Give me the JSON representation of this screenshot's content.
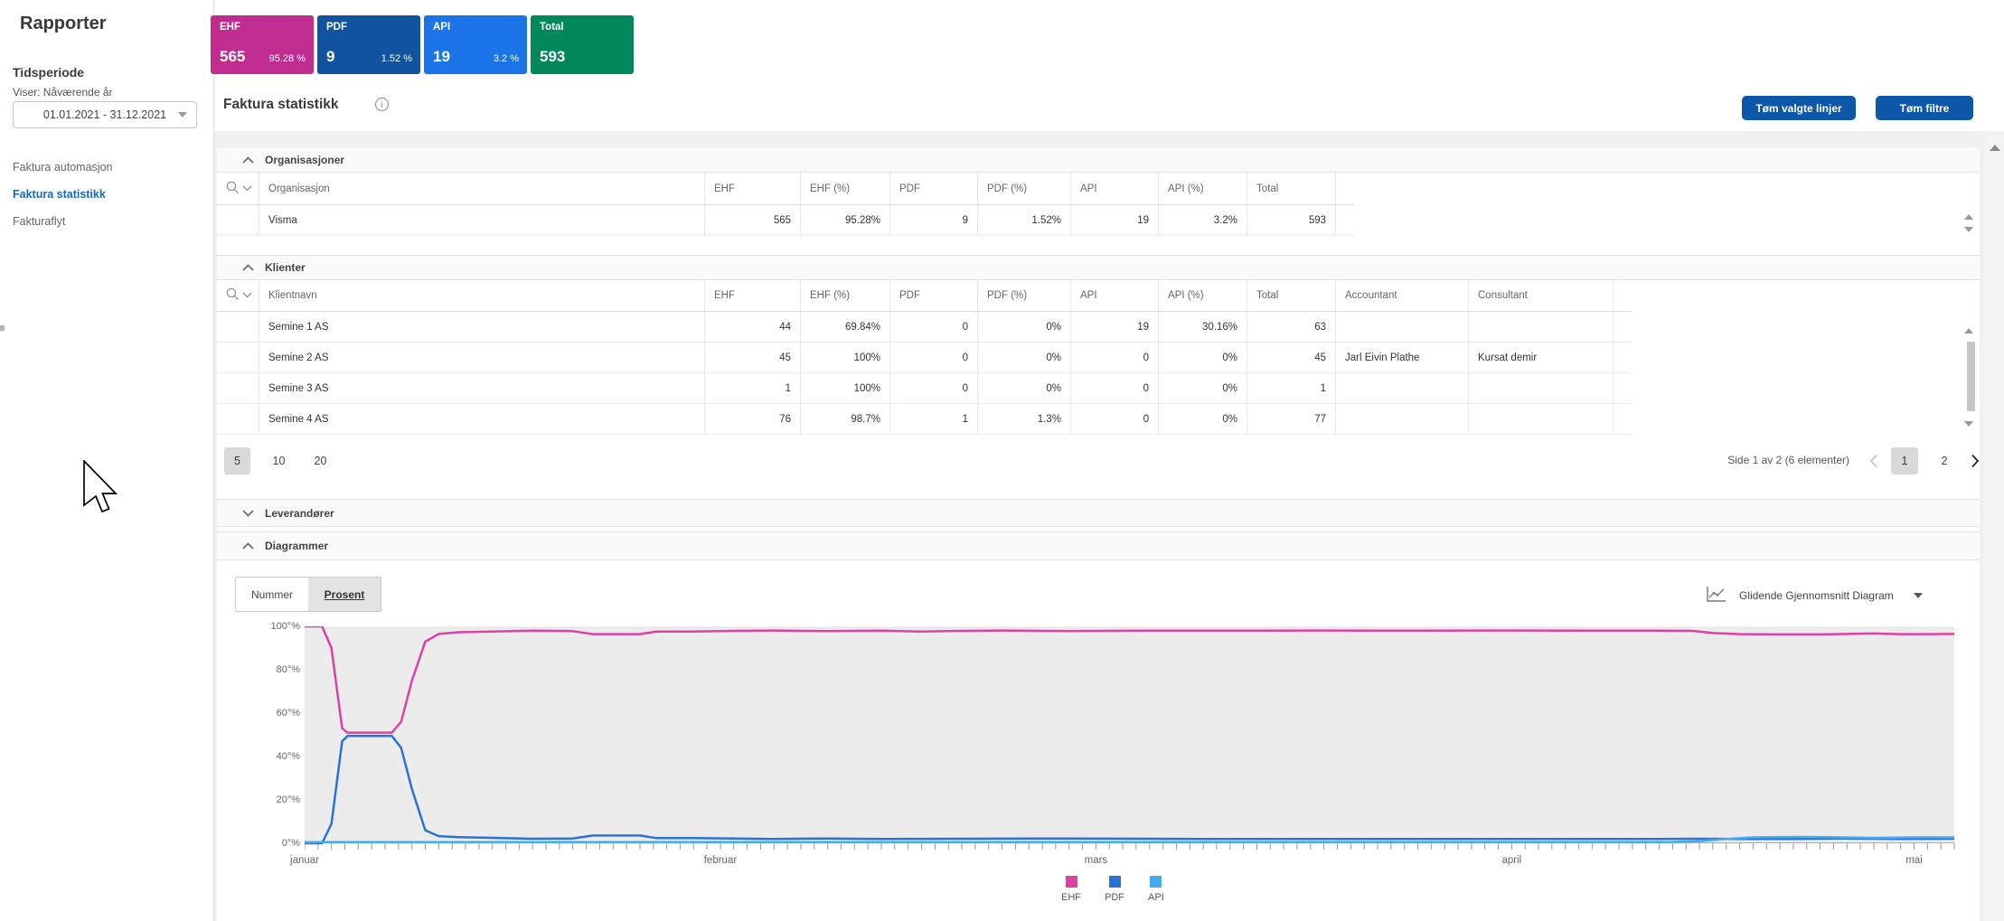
{
  "sidebar": {
    "title": "Rapporter",
    "tidsperiode_label": "Tidsperiode",
    "viser_label": "Viser: Nåværende år",
    "date_range": "01.01.2021 - 31.12.2021",
    "nav": [
      {
        "label": "Faktura automasjon",
        "active": false
      },
      {
        "label": "Faktura statistikk",
        "active": true
      },
      {
        "label": "Fakturaflyt",
        "active": false
      }
    ]
  },
  "cards": [
    {
      "label": "EHF",
      "value": "565",
      "percent": "95.28 %",
      "color": "#c02c90"
    },
    {
      "label": "PDF",
      "value": "9",
      "percent": "1.52 %",
      "color": "#11539f"
    },
    {
      "label": "API",
      "value": "19",
      "percent": "3.2 %",
      "color": "#1b74e8"
    },
    {
      "label": "Total",
      "value": "593",
      "percent": "",
      "color": "#00875a"
    }
  ],
  "header": {
    "title": "Faktura statistikk",
    "clear_lines_button": "Tøm valgte linjer",
    "clear_filters_button": "Tøm filtre"
  },
  "organisasjoner": {
    "title": "Organisasjoner",
    "columns": [
      "Organisasjon",
      "EHF",
      "EHF (%)",
      "PDF",
      "PDF (%)",
      "API",
      "API (%)",
      "Total"
    ],
    "rows": [
      [
        "Visma",
        "565",
        "95.28%",
        "9",
        "1.52%",
        "19",
        "3.2%",
        "593"
      ]
    ]
  },
  "klienter": {
    "title": "Klienter",
    "columns": [
      "Klientnavn",
      "EHF",
      "EHF (%)",
      "PDF",
      "PDF (%)",
      "API",
      "API (%)",
      "Total",
      "Accountant",
      "Consultant"
    ],
    "rows": [
      [
        "Semine 1 AS",
        "44",
        "69.84%",
        "0",
        "0%",
        "19",
        "30.16%",
        "63",
        "",
        ""
      ],
      [
        "Semine 2 AS",
        "45",
        "100%",
        "0",
        "0%",
        "0",
        "0%",
        "45",
        "Jarl Eivin Plathe",
        "Kursat demir"
      ],
      [
        "Semine 3 AS",
        "1",
        "100%",
        "0",
        "0%",
        "0",
        "0%",
        "1",
        "",
        ""
      ],
      [
        "Semine 4 AS",
        "76",
        "98.7%",
        "1",
        "1.3%",
        "0",
        "0%",
        "77",
        "",
        ""
      ]
    ]
  },
  "pagination": {
    "page_sizes": [
      "5",
      "10",
      "20"
    ],
    "selected_size": "5",
    "info": "Side 1 av 2 (6 elementer)",
    "pages": [
      "1",
      "2"
    ],
    "current_page": "1"
  },
  "leverandorer": {
    "title": "Leverandører"
  },
  "diagrammer": {
    "title": "Diagrammer",
    "toggle": {
      "options": [
        "Nummer",
        "Prosent"
      ],
      "selected": "Prosent"
    },
    "chart_type_selector": "Glidende Gjennomsnitt Diagram"
  },
  "icons": {
    "search": "magnifier",
    "filter": "chevron-down",
    "info": "circled-i",
    "collapse": "chevron-up",
    "expand": "chevron-down",
    "select_caret": "triangle-down",
    "chart_type": "line-chart",
    "prev": "chevron-left",
    "next": "chevron-right"
  },
  "chart_data": {
    "type": "line",
    "title": "",
    "xlabel": "",
    "ylabel": "",
    "x_unit": "day of year 2021",
    "xlim_days": [
      1,
      124
    ],
    "ylim": [
      0,
      100
    ],
    "grid": false,
    "legend_position": "bottom-center",
    "x_tick_labels": [
      "januar",
      "februar",
      "mars",
      "april",
      "mai"
    ],
    "x_tick_days": [
      1,
      32,
      60,
      91,
      121
    ],
    "y_tick_values": [
      0,
      20,
      40,
      60,
      80,
      100
    ],
    "y_tick_labels": [
      "0°%",
      "20°%",
      "40°%",
      "60°%",
      "80°%",
      "100°%"
    ],
    "legend": [
      "EHF",
      "PDF",
      "API"
    ],
    "series": [
      {
        "name": "EHF",
        "color": "#e03fa6",
        "points": [
          [
            1,
            100
          ],
          [
            2.3,
            100
          ],
          [
            3,
            90
          ],
          [
            3.8,
            53
          ],
          [
            4.2,
            51
          ],
          [
            7.5,
            51
          ],
          [
            8.2,
            56
          ],
          [
            9,
            75
          ],
          [
            10,
            93
          ],
          [
            11,
            96.5
          ],
          [
            12.5,
            97.3
          ],
          [
            15,
            97.6
          ],
          [
            18,
            98
          ],
          [
            21,
            97.8
          ],
          [
            22.5,
            96.4
          ],
          [
            26,
            96.4
          ],
          [
            27.2,
            97.6
          ],
          [
            30,
            97.6
          ],
          [
            33,
            97.9
          ],
          [
            36,
            98.1
          ],
          [
            40,
            97.8
          ],
          [
            44,
            98
          ],
          [
            47,
            97.6
          ],
          [
            50,
            97.9
          ],
          [
            53,
            98.1
          ],
          [
            58,
            97.8
          ],
          [
            63,
            98
          ],
          [
            70,
            98
          ],
          [
            77,
            98.1
          ],
          [
            84,
            98
          ],
          [
            91,
            98.1
          ],
          [
            97,
            98
          ],
          [
            102,
            98
          ],
          [
            104.5,
            97.9
          ],
          [
            106,
            96.9
          ],
          [
            108,
            96.4
          ],
          [
            111,
            96.3
          ],
          [
            114,
            96.3
          ],
          [
            116,
            96.5
          ],
          [
            118,
            96.7
          ],
          [
            120,
            96.4
          ],
          [
            122,
            96.4
          ],
          [
            124,
            96.5
          ]
        ]
      },
      {
        "name": "PDF",
        "color": "#2b72d7",
        "points": [
          [
            1,
            0
          ],
          [
            2.3,
            0
          ],
          [
            3,
            9
          ],
          [
            3.8,
            47
          ],
          [
            4.2,
            49.5
          ],
          [
            7.5,
            49.5
          ],
          [
            8.2,
            44
          ],
          [
            9,
            25
          ],
          [
            10,
            6
          ],
          [
            11,
            3.3
          ],
          [
            12.5,
            2.8
          ],
          [
            15,
            2.5
          ],
          [
            18,
            2.1
          ],
          [
            21,
            2.2
          ],
          [
            22.5,
            3.6
          ],
          [
            26,
            3.6
          ],
          [
            27.2,
            2.4
          ],
          [
            30,
            2.4
          ],
          [
            33,
            2.2
          ],
          [
            36,
            2
          ],
          [
            40,
            2.2
          ],
          [
            44,
            2
          ],
          [
            50,
            2.1
          ],
          [
            58,
            2.2
          ],
          [
            68,
            2
          ],
          [
            80,
            2
          ],
          [
            91,
            2
          ],
          [
            102,
            2
          ],
          [
            104.5,
            2.1
          ],
          [
            108,
            2
          ],
          [
            112,
            2
          ],
          [
            116,
            2.2
          ],
          [
            120,
            2
          ],
          [
            124,
            2.1
          ]
        ]
      },
      {
        "name": "API",
        "color": "#45aaf0",
        "points": [
          [
            1,
            0.5
          ],
          [
            20,
            0.5
          ],
          [
            40,
            0.5
          ],
          [
            60,
            0.5
          ],
          [
            80,
            0.5
          ],
          [
            95,
            0.5
          ],
          [
            100,
            0.5
          ],
          [
            103,
            0.6
          ],
          [
            105,
            1
          ],
          [
            107,
            2
          ],
          [
            109,
            2.7
          ],
          [
            112,
            2.9
          ],
          [
            115,
            2.8
          ],
          [
            118,
            2.5
          ],
          [
            121,
            2.7
          ],
          [
            124,
            2.7
          ]
        ]
      }
    ]
  }
}
